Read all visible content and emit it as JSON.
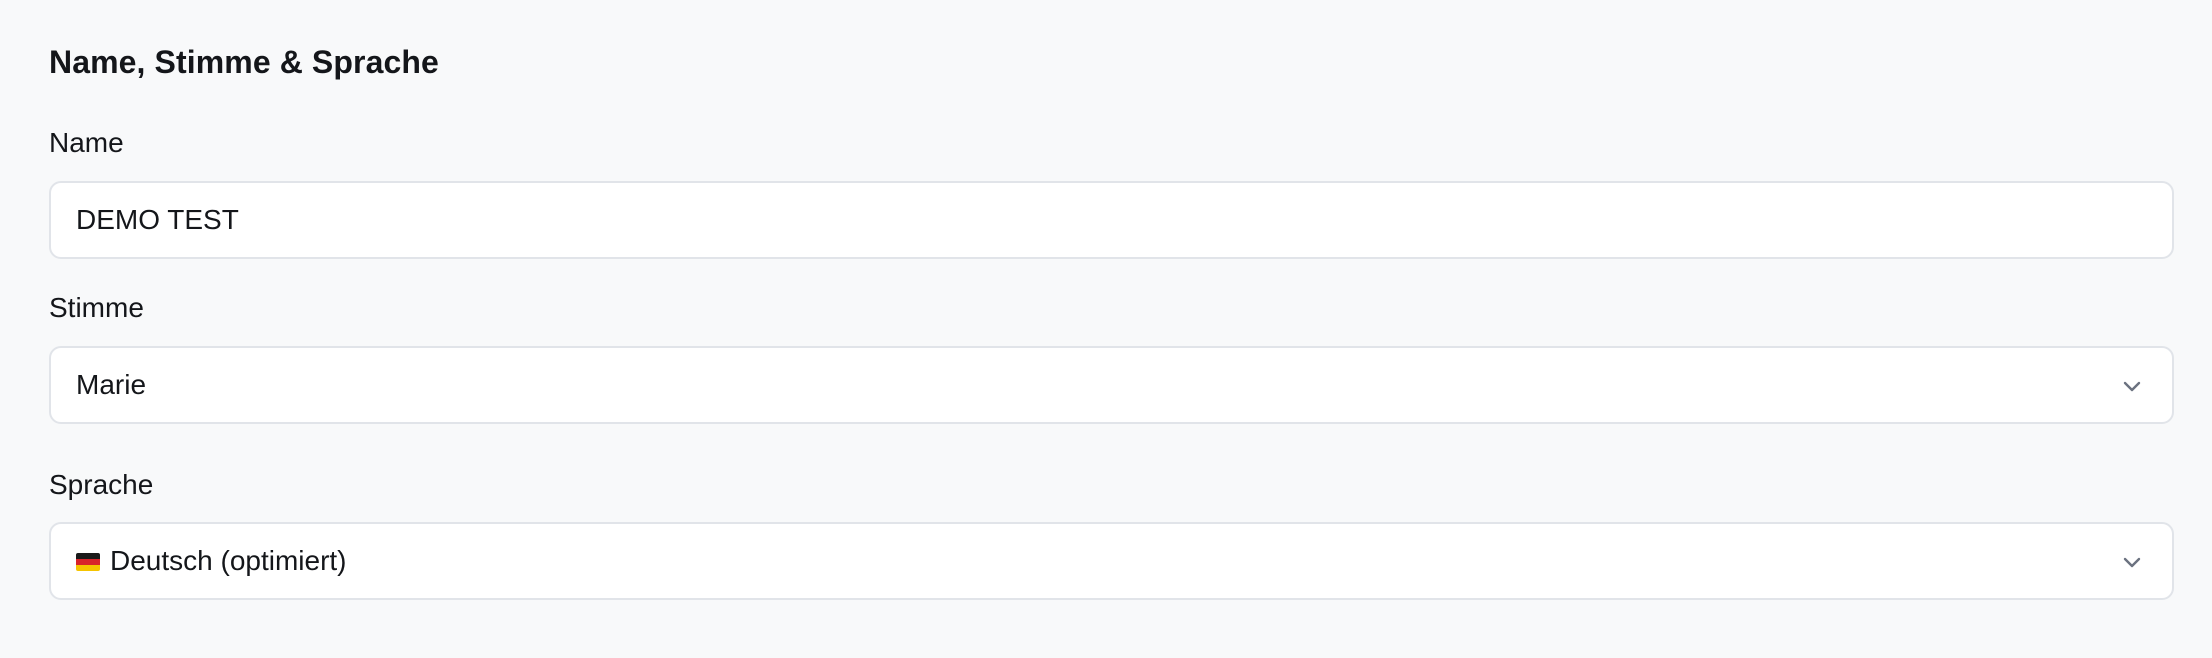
{
  "section": {
    "title": "Name, Stimme & Sprache"
  },
  "name_field": {
    "label": "Name",
    "value": "DEMO TEST"
  },
  "voice_field": {
    "label": "Stimme",
    "selected": "Marie",
    "icon": "chevron-down-icon"
  },
  "language_field": {
    "label": "Sprache",
    "selected": "Deutsch (optimiert)",
    "flag_icon": "flag-de-icon",
    "icon": "chevron-down-icon"
  },
  "colors": {
    "background": "#f8f9fa",
    "field_border": "#e1e4e9",
    "text": "#14161a",
    "chevron": "#6b7280"
  }
}
